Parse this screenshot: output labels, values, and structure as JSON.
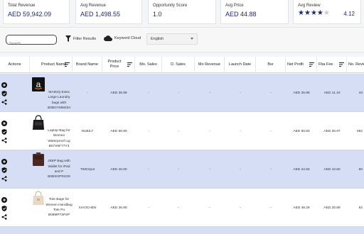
{
  "kpis": [
    {
      "label": "Total Revenue",
      "value": "AED 59,942.09"
    },
    {
      "label": "Avg Revenue",
      "value": "AED 1,498.55"
    },
    {
      "label": "Opportunity Score",
      "value": "1.0"
    },
    {
      "label": "Avg Price",
      "value": "AED 44.88"
    },
    {
      "label": "Avg Review",
      "value": "4.12",
      "stars_filled": 4,
      "stars_total": 5
    }
  ],
  "toolbar": {
    "search_placeholder": "Search",
    "filter_label": "Filter Results",
    "keyword_label": "Keyword Cloud",
    "language": "English"
  },
  "columns": [
    "Actions",
    "Product Name",
    "Brand Name",
    "Product Price",
    "Mo. Sales",
    "D. Sales",
    "Mo Revenue",
    "Launch Date",
    "Bsr",
    "Net Profit",
    "Fba Fee",
    "No. Review"
  ],
  "rows": [
    {
      "name": "MAIKIQ Extra Large Laundry bags with",
      "asin": "B0BGYMM434",
      "brand": "-",
      "price": "AED 36.99",
      "mo_sales": "-",
      "d_sales": "-",
      "mo_revenue": "-",
      "launch": "-",
      "bsr": "-",
      "net_profit": "AED 25.89",
      "fba_fee": "AED 11.10",
      "reviews": "43"
    },
    {
      "name": "Laptop Bag for Women Waterproof Lig",
      "asin": "B07X5F77Y3",
      "brand": "NUBILY",
      "price": "AED 66.90",
      "mo_sales": "-",
      "d_sales": "-",
      "mo_revenue": "-",
      "launch": "-",
      "bsr": "-",
      "net_profit": "AED 60.83",
      "fba_fee": "AED 26.07",
      "reviews": "692"
    },
    {
      "name": "JEEP Bag with Wallet for iPad and P",
      "asin": "B0BSGPR2G9",
      "brand": "TIMOrpot",
      "price": "AED 40.00",
      "mo_sales": "-",
      "d_sales": "-",
      "mo_revenue": "-",
      "launch": "-",
      "bsr": "-",
      "net_profit": "AED 24.50",
      "fba_fee": "AED 10.50",
      "reviews": "60"
    },
    {
      "name": "Tote Bags for Women Handbag Tote Pu",
      "asin": "B08MP72P2P",
      "brand": "XIAOCHEN",
      "price": "AED 36.90",
      "mo_sales": "-",
      "d_sales": "-",
      "mo_revenue": "-",
      "launch": "-",
      "bsr": "-",
      "net_profit": "AED 48.29",
      "fba_fee": "AED 20.69",
      "reviews": "82"
    }
  ]
}
